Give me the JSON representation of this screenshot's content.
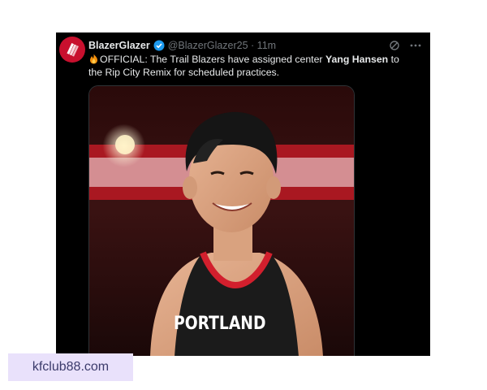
{
  "tweet": {
    "display_name": "BlazerGlazer",
    "handle_time": "@BlazerGlazer25 · 11m",
    "text_before": "OFFICIAL: The Trail Blazers have assigned center ",
    "text_bold": "Yang Hansen",
    "text_after": " to the Rip City Remix for scheduled practices.",
    "jersey_text": "PORTLAND",
    "icons": {
      "avatar": "pinwheel-logo-icon",
      "verified": "verified-badge-icon",
      "grok": "grok-icon",
      "more": "more-options-icon",
      "emoji": "fire-emoji-icon"
    }
  },
  "watermark": "kfclub88.com",
  "colors": {
    "card_bg": "#000000",
    "text_primary": "#e7e9ea",
    "text_secondary": "#71767b",
    "verified_blue": "#1d9bf0",
    "blazers_red": "#c8102e",
    "watermark_bg": "#e9e1fb"
  }
}
